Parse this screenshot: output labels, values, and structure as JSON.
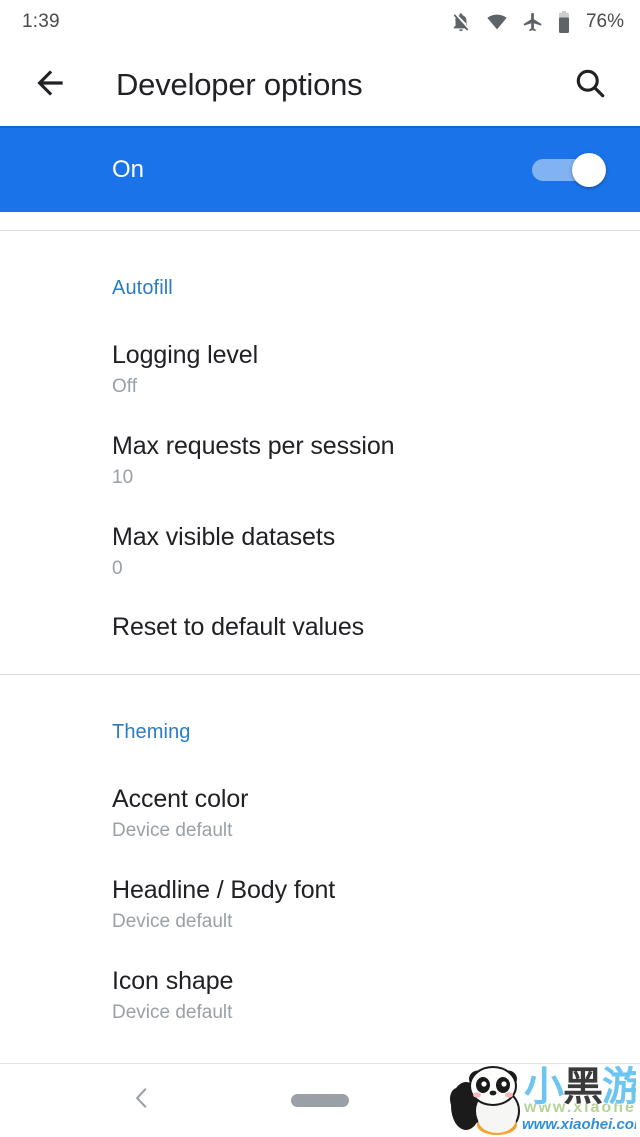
{
  "status_bar": {
    "time": "1:39",
    "battery_percent": "76%",
    "icons": [
      "notifications-off-icon",
      "wifi-icon",
      "airplane-mode-icon",
      "battery-icon"
    ]
  },
  "toolbar": {
    "back_icon": "arrow-back-icon",
    "title": "Developer options",
    "search_icon": "search-icon"
  },
  "master_switch": {
    "label": "On",
    "state": "on",
    "banner_color": "#1a73e8"
  },
  "sections": [
    {
      "header": "Autofill",
      "items": [
        {
          "title": "Logging level",
          "subtitle": "Off"
        },
        {
          "title": "Max requests per session",
          "subtitle": "10"
        },
        {
          "title": "Max visible datasets",
          "subtitle": "0"
        },
        {
          "title": "Reset to default values",
          "subtitle": ""
        }
      ]
    },
    {
      "header": "Theming",
      "items": [
        {
          "title": "Accent color",
          "subtitle": "Device default"
        },
        {
          "title": "Headline / Body font",
          "subtitle": "Device default"
        },
        {
          "title": "Icon shape",
          "subtitle": "Device default"
        }
      ]
    }
  ],
  "nav_bar": {
    "back_icon": "chevron-left-icon",
    "home_pill": "gesture-home-pill"
  },
  "watermark": {
    "brand_cn": "小黑游戏",
    "brand_cn_part1": "小",
    "brand_cn_part2": "黑",
    "brand_cn_part3": "游戏",
    "url": "www.xiaohei.com",
    "faded_text": "www.xiaohei.com",
    "mascot": "panda-mascot-icon"
  },
  "colors": {
    "accent_blue": "#1a73e8",
    "section_header_blue": "#2b7cc4",
    "title_text": "#202124",
    "subtitle_text": "#9aa0a6",
    "divider": "#dadce0"
  }
}
